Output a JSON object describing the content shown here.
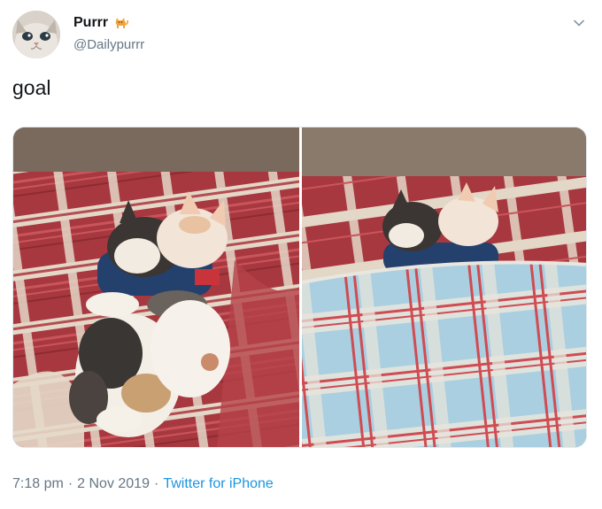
{
  "author": {
    "display_name": "Purrr",
    "handle": "@Dailypurrr",
    "name_emoji": "cat-emoji",
    "avatar": "cat-face-avatar"
  },
  "tweet": {
    "text": "goal"
  },
  "media": {
    "photos": [
      {
        "icon": "kittens-hugging-on-blanket-photo"
      },
      {
        "icon": "kittens-tucked-under-blanket-photo"
      }
    ]
  },
  "meta": {
    "time": "7:18 pm",
    "separator1": "·",
    "date": "2 Nov 2019",
    "separator2": "·",
    "source": "Twitter for iPhone"
  },
  "colors": {
    "link_blue": "#1b95e0",
    "secondary_text": "#657786",
    "primary_text": "#14171a"
  },
  "icons": {
    "caret": "chevron-down-icon"
  }
}
